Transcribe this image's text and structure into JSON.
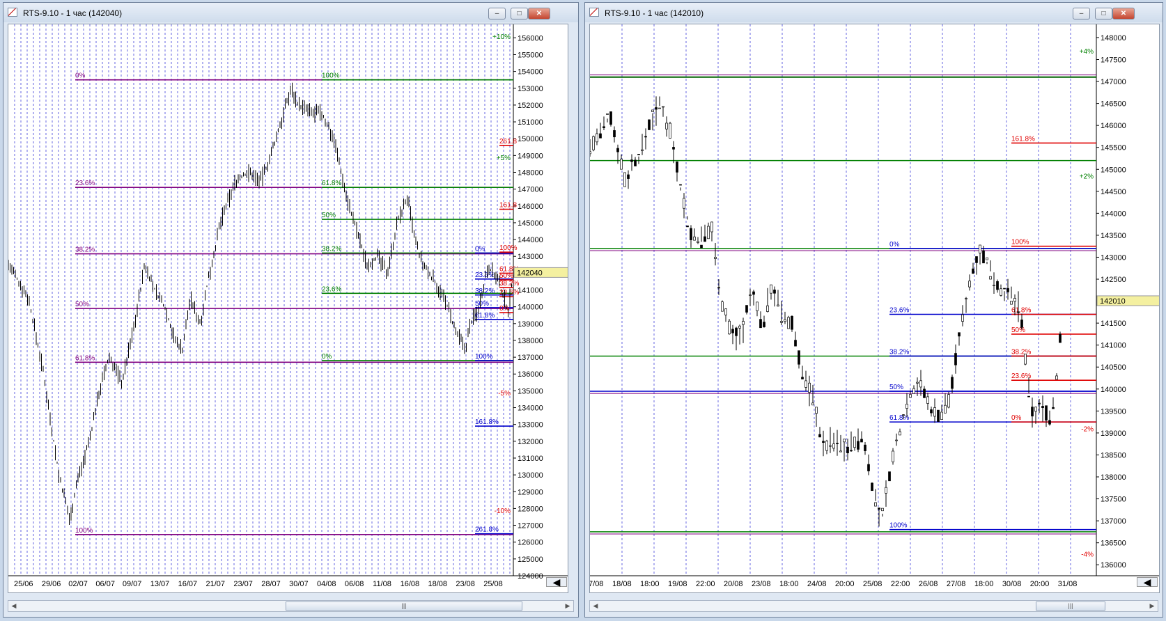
{
  "left": {
    "title": "RTS-9.10 - 1 час (142040)",
    "price_min": 124000,
    "price_max": 156800,
    "y_ticks": [
      "156000",
      "155000",
      "154000",
      "153000",
      "152000",
      "151000",
      "150000",
      "149000",
      "148000",
      "147000",
      "146000",
      "145000",
      "144000",
      "143000",
      "142000",
      "141000",
      "140000",
      "139000",
      "138000",
      "137000",
      "136000",
      "135000",
      "134000",
      "133000",
      "132000",
      "131000",
      "130000",
      "129000",
      "128000",
      "127000",
      "126000",
      "125000",
      "124000"
    ],
    "y_tick_values": [
      156000,
      155000,
      154000,
      153000,
      152000,
      151000,
      150000,
      149000,
      148000,
      147000,
      146000,
      145000,
      144000,
      143000,
      142000,
      141000,
      140000,
      139000,
      138000,
      137000,
      136000,
      135000,
      134000,
      133000,
      132000,
      131000,
      130000,
      129000,
      128000,
      127000,
      126000,
      125000,
      124000
    ],
    "x_labels": [
      "25/06",
      "29/06",
      "02/07",
      "06/07",
      "09/07",
      "13/07",
      "16/07",
      "21/07",
      "23/07",
      "28/07",
      "30/07",
      "04/08",
      "06/08",
      "11/08",
      "16/08",
      "18/08",
      "23/08",
      "25/08"
    ],
    "x_label_frac": [
      0.03,
      0.085,
      0.138,
      0.192,
      0.245,
      0.3,
      0.355,
      0.41,
      0.465,
      0.52,
      0.575,
      0.63,
      0.685,
      0.74,
      0.795,
      0.85,
      0.905,
      0.96
    ],
    "current_price": "142040",
    "current_value": 142040,
    "fib_purple": [
      {
        "label": "0%",
        "value": 153500
      },
      {
        "label": "23.6%",
        "value": 147100
      },
      {
        "label": "38.2%",
        "value": 143150
      },
      {
        "label": "50%",
        "value": 139900
      },
      {
        "label": "61.8%",
        "value": 136700
      },
      {
        "label": "100%",
        "value": 126450
      }
    ],
    "fib_green": [
      {
        "label": "100%",
        "value": 153500
      },
      {
        "label": "61.8%",
        "value": 147100
      },
      {
        "label": "50%",
        "value": 145200
      },
      {
        "label": "38.2%",
        "value": 143200
      },
      {
        "label": "23.6%",
        "value": 140800
      },
      {
        "label": "0%",
        "value": 136800
      }
    ],
    "fib_blue": [
      {
        "label": "0%",
        "value": 143200
      },
      {
        "label": "23.6%",
        "value": 141650
      },
      {
        "label": "38.2%",
        "value": 140700
      },
      {
        "label": "50%",
        "value": 139950
      },
      {
        "label": "61.8%",
        "value": 139250
      },
      {
        "label": "100%",
        "value": 136800
      },
      {
        "label": "161.8%",
        "value": 132900
      },
      {
        "label": "261.8%",
        "value": 126500
      }
    ],
    "fib_red": [
      {
        "label": "261.8",
        "value": 149600
      },
      {
        "label": "161.8",
        "value": 145800
      },
      {
        "label": "100%",
        "value": 143250
      },
      {
        "label": "61.8%",
        "value": 142000
      },
      {
        "label": "50%",
        "value": 141600
      },
      {
        "label": "38.2%",
        "value": 141150
      },
      {
        "label": "23.6%",
        "value": 140600
      },
      {
        "label": "0%",
        "value": 139650
      }
    ],
    "pct_labels": [
      {
        "label": "+10%",
        "value": 156100,
        "color": "green"
      },
      {
        "label": "+5%",
        "value": 148900,
        "color": "green"
      },
      {
        "label": "-5%",
        "value": 134900,
        "color": "red"
      },
      {
        "label": "-10%",
        "value": 127900,
        "color": "red"
      }
    ],
    "trend_points": [
      [
        0.0,
        142500
      ],
      [
        0.04,
        140500
      ],
      [
        0.07,
        136000
      ],
      [
        0.1,
        130000
      ],
      [
        0.122,
        127300
      ],
      [
        0.135,
        129500
      ],
      [
        0.16,
        132000
      ],
      [
        0.18,
        135000
      ],
      [
        0.2,
        137000
      ],
      [
        0.225,
        135500
      ],
      [
        0.25,
        139000
      ],
      [
        0.27,
        142500
      ],
      [
        0.29,
        141000
      ],
      [
        0.31,
        140000
      ],
      [
        0.33,
        138000
      ],
      [
        0.345,
        137500
      ],
      [
        0.36,
        140500
      ],
      [
        0.38,
        139000
      ],
      [
        0.395,
        141500
      ],
      [
        0.42,
        145000
      ],
      [
        0.45,
        147500
      ],
      [
        0.475,
        148000
      ],
      [
        0.5,
        147500
      ],
      [
        0.52,
        149000
      ],
      [
        0.545,
        151500
      ],
      [
        0.56,
        153000
      ],
      [
        0.575,
        152000
      ],
      [
        0.6,
        151500
      ],
      [
        0.62,
        151500
      ],
      [
        0.645,
        150000
      ],
      [
        0.67,
        146500
      ],
      [
        0.69,
        144500
      ],
      [
        0.71,
        142500
      ],
      [
        0.73,
        143000
      ],
      [
        0.75,
        142000
      ],
      [
        0.77,
        145000
      ],
      [
        0.79,
        146500
      ],
      [
        0.805,
        144000
      ],
      [
        0.82,
        142500
      ],
      [
        0.845,
        141500
      ],
      [
        0.87,
        140000
      ],
      [
        0.885,
        138500
      ],
      [
        0.905,
        137500
      ],
      [
        0.915,
        139000
      ],
      [
        0.93,
        139800
      ],
      [
        0.95,
        142500
      ],
      [
        0.97,
        141500
      ],
      [
        0.99,
        139800
      ],
      [
        1.0,
        142040
      ]
    ]
  },
  "right": {
    "title": "RTS-9.10 - 1 час (142010)",
    "price_min": 135750,
    "price_max": 148300,
    "y_ticks": [
      "148000",
      "147500",
      "147000",
      "146500",
      "146000",
      "145500",
      "145000",
      "144500",
      "144000",
      "143500",
      "143000",
      "142500",
      "142000",
      "141500",
      "141000",
      "140500",
      "140000",
      "139500",
      "139000",
      "138500",
      "138000",
      "137500",
      "137000",
      "136500",
      "136000"
    ],
    "y_tick_values": [
      148000,
      147500,
      147000,
      146500,
      146000,
      145500,
      145000,
      144500,
      144000,
      143500,
      143000,
      142500,
      142000,
      141500,
      141000,
      140500,
      140000,
      139500,
      139000,
      138500,
      138000,
      137500,
      137000,
      136500,
      136000
    ],
    "x_labels": [
      "7/08",
      "18/08",
      "18:00",
      "19/08",
      "22:00",
      "20/08",
      "23/08",
      "18:00",
      "24/08",
      "20:00",
      "25/08",
      "22:00",
      "26/08",
      "27/08",
      "18:00",
      "30/08",
      "20:00",
      "31/08"
    ],
    "x_label_frac": [
      0.012,
      0.063,
      0.118,
      0.173,
      0.228,
      0.283,
      0.338,
      0.393,
      0.448,
      0.503,
      0.558,
      0.613,
      0.668,
      0.723,
      0.778,
      0.833,
      0.888,
      0.943
    ],
    "current_price": "142010",
    "current_value": 142010,
    "lines": [
      {
        "value": 147100,
        "color": "#006400",
        "w": 2
      },
      {
        "value": 147150,
        "color": "#800080",
        "w": 1
      },
      {
        "value": 145200,
        "color": "#008000",
        "w": 1.5
      },
      {
        "value": 143200,
        "color": "#008000",
        "w": 1.5
      },
      {
        "value": 143150,
        "color": "#800080",
        "w": 1
      },
      {
        "value": 140750,
        "color": "#008000",
        "w": 1.5
      },
      {
        "value": 139950,
        "color": "#0000cc",
        "w": 1.5
      },
      {
        "value": 139900,
        "color": "#800080",
        "w": 1
      },
      {
        "value": 136750,
        "color": "#008000",
        "w": 1.5
      },
      {
        "value": 136700,
        "color": "#800080",
        "w": 1
      }
    ],
    "fib_blue": [
      {
        "label": "0%",
        "value": 143200
      },
      {
        "label": "23.6%",
        "value": 141700
      },
      {
        "label": "38.2%",
        "value": 140750
      },
      {
        "label": "50%",
        "value": 139950
      },
      {
        "label": "61.8%",
        "value": 139250
      },
      {
        "label": "100%",
        "value": 136800
      }
    ],
    "fib_red": [
      {
        "label": "161.8%",
        "value": 145600
      },
      {
        "label": "100%",
        "value": 143250
      },
      {
        "label": "61.8%",
        "value": 141700
      },
      {
        "label": "50%",
        "value": 141250
      },
      {
        "label": "38.2%",
        "value": 140750
      },
      {
        "label": "23.6%",
        "value": 140200
      },
      {
        "label": "0%",
        "value": 139250
      }
    ],
    "pct_labels": [
      {
        "label": "+4%",
        "value": 147700,
        "color": "green"
      },
      {
        "label": "+2%",
        "value": 144850,
        "color": "green"
      },
      {
        "label": "-2%",
        "value": 139100,
        "color": "red"
      },
      {
        "label": "-4%",
        "value": 136250,
        "color": "red"
      }
    ],
    "trend_points": [
      [
        0.0,
        145500
      ],
      [
        0.02,
        145800
      ],
      [
        0.04,
        146200
      ],
      [
        0.055,
        145500
      ],
      [
        0.07,
        144700
      ],
      [
        0.085,
        145200
      ],
      [
        0.1,
        145300
      ],
      [
        0.115,
        146000
      ],
      [
        0.14,
        146500
      ],
      [
        0.16,
        145800
      ],
      [
        0.18,
        144500
      ],
      [
        0.2,
        143500
      ],
      [
        0.22,
        143400
      ],
      [
        0.24,
        143700
      ],
      [
        0.26,
        142000
      ],
      [
        0.28,
        141200
      ],
      [
        0.3,
        141300
      ],
      [
        0.32,
        142200
      ],
      [
        0.34,
        141400
      ],
      [
        0.36,
        142400
      ],
      [
        0.38,
        141600
      ],
      [
        0.4,
        141500
      ],
      [
        0.42,
        140300
      ],
      [
        0.44,
        139800
      ],
      [
        0.46,
        138700
      ],
      [
        0.48,
        138800
      ],
      [
        0.5,
        138700
      ],
      [
        0.52,
        138700
      ],
      [
        0.54,
        138900
      ],
      [
        0.56,
        137700
      ],
      [
        0.575,
        136900
      ],
      [
        0.59,
        138000
      ],
      [
        0.61,
        139000
      ],
      [
        0.63,
        139900
      ],
      [
        0.65,
        140200
      ],
      [
        0.67,
        139600
      ],
      [
        0.69,
        139400
      ],
      [
        0.71,
        139800
      ],
      [
        0.73,
        141200
      ],
      [
        0.75,
        142500
      ],
      [
        0.77,
        143200
      ],
      [
        0.79,
        142700
      ],
      [
        0.81,
        142300
      ],
      [
        0.83,
        142100
      ],
      [
        0.85,
        141800
      ],
      [
        0.865,
        140000
      ],
      [
        0.875,
        139400
      ],
      [
        0.89,
        139600
      ],
      [
        0.91,
        139300
      ],
      [
        0.92,
        140100
      ],
      [
        0.935,
        142010
      ]
    ]
  },
  "nav_arrow": "◀",
  "scroll_grip": "|||",
  "btn_min": "–",
  "btn_max": "□",
  "btn_close": "✕"
}
